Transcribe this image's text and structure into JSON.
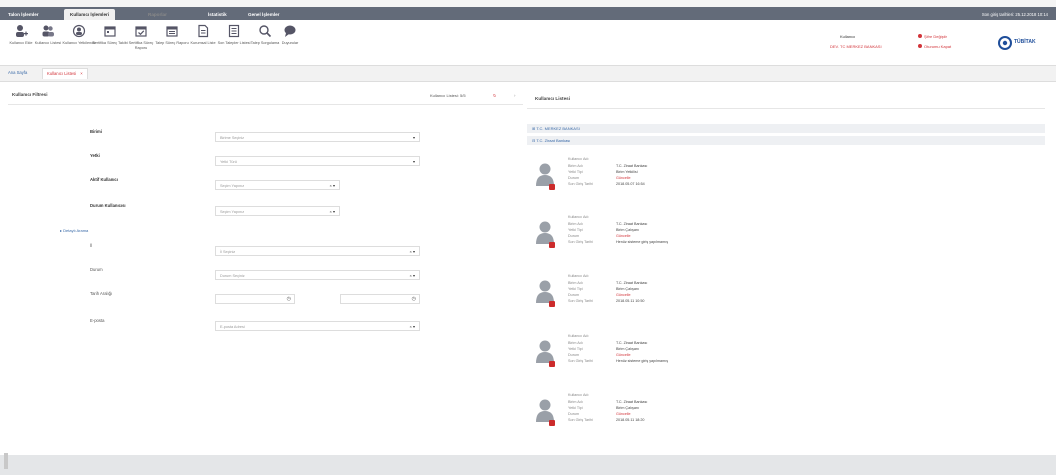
{
  "menubar": {
    "tabs": [
      {
        "label": "Talon İşlemler"
      },
      {
        "label": "Kullanıcı İşlemleri"
      },
      {
        "label": "Raporlar"
      },
      {
        "label": "İstatistik"
      },
      {
        "label": "Genel İşlemler"
      }
    ],
    "datetime": "Son giriş tarihleri: 25.12.2018 10:14"
  },
  "toolbar": {
    "buttons": [
      {
        "label": "Kullanıcı Ekle",
        "icon": "user-add-icon"
      },
      {
        "label": "Kullanıcı Listesi",
        "icon": "users-icon"
      },
      {
        "label": "Kullanıcı Yetkilendir",
        "icon": "user-key-icon"
      },
      {
        "label": "Sertifika Süreç Takibi",
        "icon": "calendar-icon"
      },
      {
        "label": "Sertifika Süreç Raporu",
        "icon": "calendar-check-icon"
      },
      {
        "label": "Talep Süreç Raporu",
        "icon": "calendar-list-icon"
      },
      {
        "label": "Kurumsal Liste",
        "icon": "document-icon"
      },
      {
        "label": "Son Talepler Listesi",
        "icon": "list-doc-icon"
      },
      {
        "label": "Talep Sorgulama",
        "icon": "search-icon"
      },
      {
        "label": "Duyurular",
        "icon": "chat-icon"
      }
    ],
    "user": {
      "name": "Kullanıcı",
      "org": "DEV. TC MERKEZ BANKASI",
      "link1": "Şifre Değiştir",
      "link2": "Oturumu Kapat"
    },
    "logo": "TÜBİTAK"
  },
  "tabs": [
    {
      "label": "Ana Sayfa"
    },
    {
      "label": "Kullanıcı Listesi"
    }
  ],
  "left": {
    "header": "Kullanıcı Filtresi",
    "counter": "Kullanıcı Listesi: 5/5",
    "fields": [
      {
        "label": "Birimi",
        "placeholder": "Birime Seçiniz"
      },
      {
        "label": "Yetki",
        "placeholder": "Yetki Türü"
      },
      {
        "label": "Aktif Kullanıcı",
        "placeholder": "Seçim Yapınız"
      },
      {
        "label": "Durum Kullanıcısı",
        "placeholder": "Seçim Yapınız"
      }
    ],
    "section": "Detaylı Arama",
    "detail": [
      {
        "label": "İl",
        "placeholder": "İl Seçiniz"
      },
      {
        "label": "Durum",
        "placeholder": "Durum Seçiniz"
      },
      {
        "label": "Tarih Aralığı",
        "placeholder": ""
      },
      {
        "label": "E-posta",
        "placeholder": "E-posta Adresi"
      }
    ]
  },
  "right": {
    "title": "Kullanıcı Listesi",
    "groups": [
      {
        "label": "T.C. MERKEZ BANKASI"
      },
      {
        "label": "T.C. Ziraat Bankası"
      }
    ],
    "keys": [
      "Kullanıcı Adı",
      "Birim Adı",
      "Yetki Tipi",
      "Durum",
      "Son Giriş Tarihi"
    ],
    "users": [
      {
        "unit": "T.C. Ziraat Bankası",
        "role": "Birim Yetkilisi",
        "status": "Güncelle",
        "last": "2018.05.07 16:54"
      },
      {
        "unit": "T.C. Ziraat Bankası",
        "role": "Birim Çalışanı",
        "status": "Güncelle",
        "last": "Henüz sisteme giriş yapılmamış"
      },
      {
        "unit": "T.C. Ziraat Bankası",
        "role": "Birim Çalışanı",
        "status": "Güncelle",
        "last": "2018.05.11 10:50"
      },
      {
        "unit": "T.C. Ziraat Bankası",
        "role": "Birim Çalışanı",
        "status": "Güncelle",
        "last": "Henüz sisteme giriş yapılmamış"
      },
      {
        "unit": "T.C. Ziraat Bankası",
        "role": "Birim Çalışanı",
        "status": "Güncelle",
        "last": "2018.05.11 18:20"
      }
    ]
  },
  "colors": {
    "menubar": "#636b79",
    "accent_red": "#d2343a",
    "link_blue": "#3a6aa8"
  }
}
